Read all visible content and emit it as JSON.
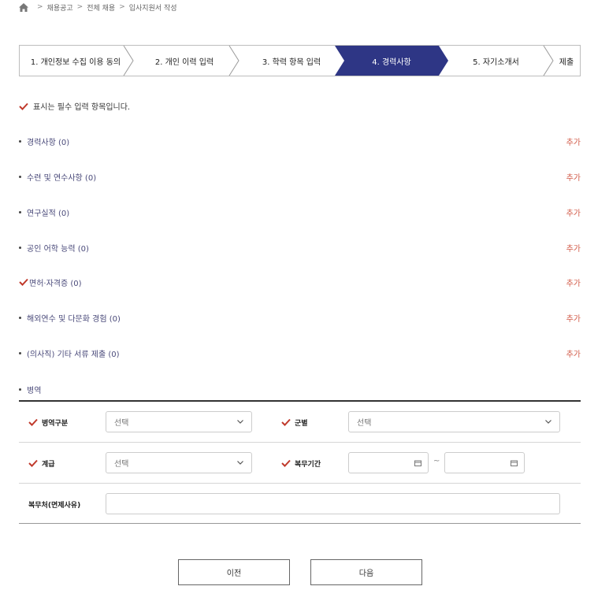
{
  "breadcrumb": {
    "items": [
      "채용공고",
      "전체 채용",
      "입사지원서 작성"
    ]
  },
  "steps": [
    {
      "label": "1. 개인정보 수집 이용 동의",
      "active": false
    },
    {
      "label": "2. 개인 이력 입력",
      "active": false
    },
    {
      "label": "3. 학력 항목 입력",
      "active": false
    },
    {
      "label": "4. 경력사항",
      "active": true
    },
    {
      "label": "5. 자기소개서",
      "active": false
    },
    {
      "label": "제출",
      "active": false
    }
  ],
  "required_note": "표시는 필수 입력 항목입니다.",
  "sections": [
    {
      "label": "경력사항 (0)",
      "add": "추가",
      "required": false
    },
    {
      "label": "수련 및 연수사항 (0)",
      "add": "추가",
      "required": false
    },
    {
      "label": "연구실적 (0)",
      "add": "추가",
      "required": false
    },
    {
      "label": "공인 어학 능력 (0)",
      "add": "추가",
      "required": false
    },
    {
      "label": "면허·자격증 (0)",
      "add": "추가",
      "required": true
    },
    {
      "label": "해외연수 및 다문화 경험 (0)",
      "add": "추가",
      "required": false
    },
    {
      "label": "(의사직) 기타 서류 제출 (0)",
      "add": "추가",
      "required": false
    }
  ],
  "military": {
    "title": "병역",
    "type_label": "병역구분",
    "type_value": "선택",
    "branch_label": "군별",
    "branch_value": "선택",
    "rank_label": "계급",
    "rank_value": "선택",
    "period_label": "복무기간",
    "period_sep": "~",
    "place_label": "복무처(면제사유)",
    "place_value": ""
  },
  "buttons": {
    "prev": "이전",
    "next": "다음"
  },
  "colors": {
    "active_step": "#2e3685",
    "check": "#c0392b",
    "add_link": "#d25c4a"
  }
}
